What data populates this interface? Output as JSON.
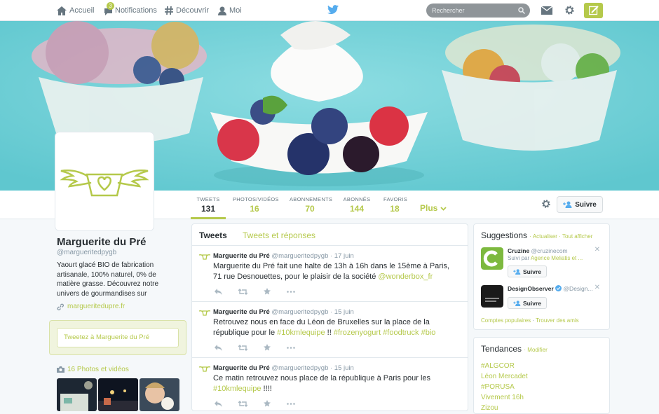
{
  "topbar": {
    "home_label": "Accueil",
    "notifications_label": "Notifications",
    "notifications_badge": "3",
    "discover_label": "Découvrir",
    "me_label": "Moi",
    "search_placeholder": "Rechercher"
  },
  "profile": {
    "name": "Marguerite du Pré",
    "handle": "@margueritedpygb",
    "bio": "Yaourt glacé BIO de fabrication artisanale, 100% naturel, 0% de matière grasse. Découvrez notre univers de gourmandises sur",
    "url": "margueritedupre.fr",
    "tweet_to_placeholder": "Tweetez à Marguerite du Pré",
    "photos_label": "16 Photos et vidéos"
  },
  "stats": [
    {
      "label": "TWEETS",
      "value": "131"
    },
    {
      "label": "PHOTOS/VIDÉOS",
      "value": "16"
    },
    {
      "label": "ABONNEMENTS",
      "value": "70"
    },
    {
      "label": "ABONNÉS",
      "value": "144"
    },
    {
      "label": "FAVORIS",
      "value": "18"
    }
  ],
  "more_label": "Plus",
  "follow_label": "Suivre",
  "timeline": {
    "tab_tweets": "Tweets",
    "tab_replies": "Tweets et réponses",
    "tweets": [
      {
        "author": "Marguerite du Pré",
        "handle": "@margueritedpygb",
        "date": "· 17 juin",
        "text": "Marguerite du Pré fait une halte de 13h à 16h dans le 15ème à Paris, 71 rue Desnouettes, pour le plaisir de la société ",
        "link": "@wonderbox_fr"
      },
      {
        "author": "Marguerite du Pré",
        "handle": "@margueritedpygb",
        "date": "· 15 juin",
        "text": "Retrouvez nous en face du Léon de Bruxelles sur la place de la république pour le ",
        "tag1": "#10kmlequipe",
        "mid": " !! ",
        "tag2": "#frozenyogurt",
        "tag3": "#foodtruck",
        "tag4": "#bio"
      },
      {
        "author": "Marguerite du Pré",
        "handle": "@margueritedpygb",
        "date": "· 15 juin",
        "text": "Ce matin retrouvez nous place de la république à Paris pour les ",
        "tag1": "#10kmlequipe",
        "tail": " !!!!"
      }
    ]
  },
  "suggestions": {
    "title": "Suggestions",
    "refresh": "Actualiser",
    "all": "Tout afficher",
    "items": [
      {
        "name": "Cruzine",
        "handle": "@cruzinecom",
        "followed_by_prefix": "Suivi par ",
        "followed_by": "Agence Meliatis et ...",
        "button": "Suivre"
      },
      {
        "name": "DesignObserver",
        "handle": "@Design...",
        "button": "Suivre"
      }
    ],
    "popular": "Comptes populaires",
    "find": "Trouver des amis"
  },
  "trends": {
    "title": "Tendances",
    "change": "Modifier",
    "items": [
      "#ALGCOR",
      "Léon Mercadet",
      "#PORUSA",
      "Vivement 16h",
      "Zizou"
    ]
  },
  "colors": {
    "accent": "#b5c94b",
    "banner": "#6fd0d6"
  }
}
